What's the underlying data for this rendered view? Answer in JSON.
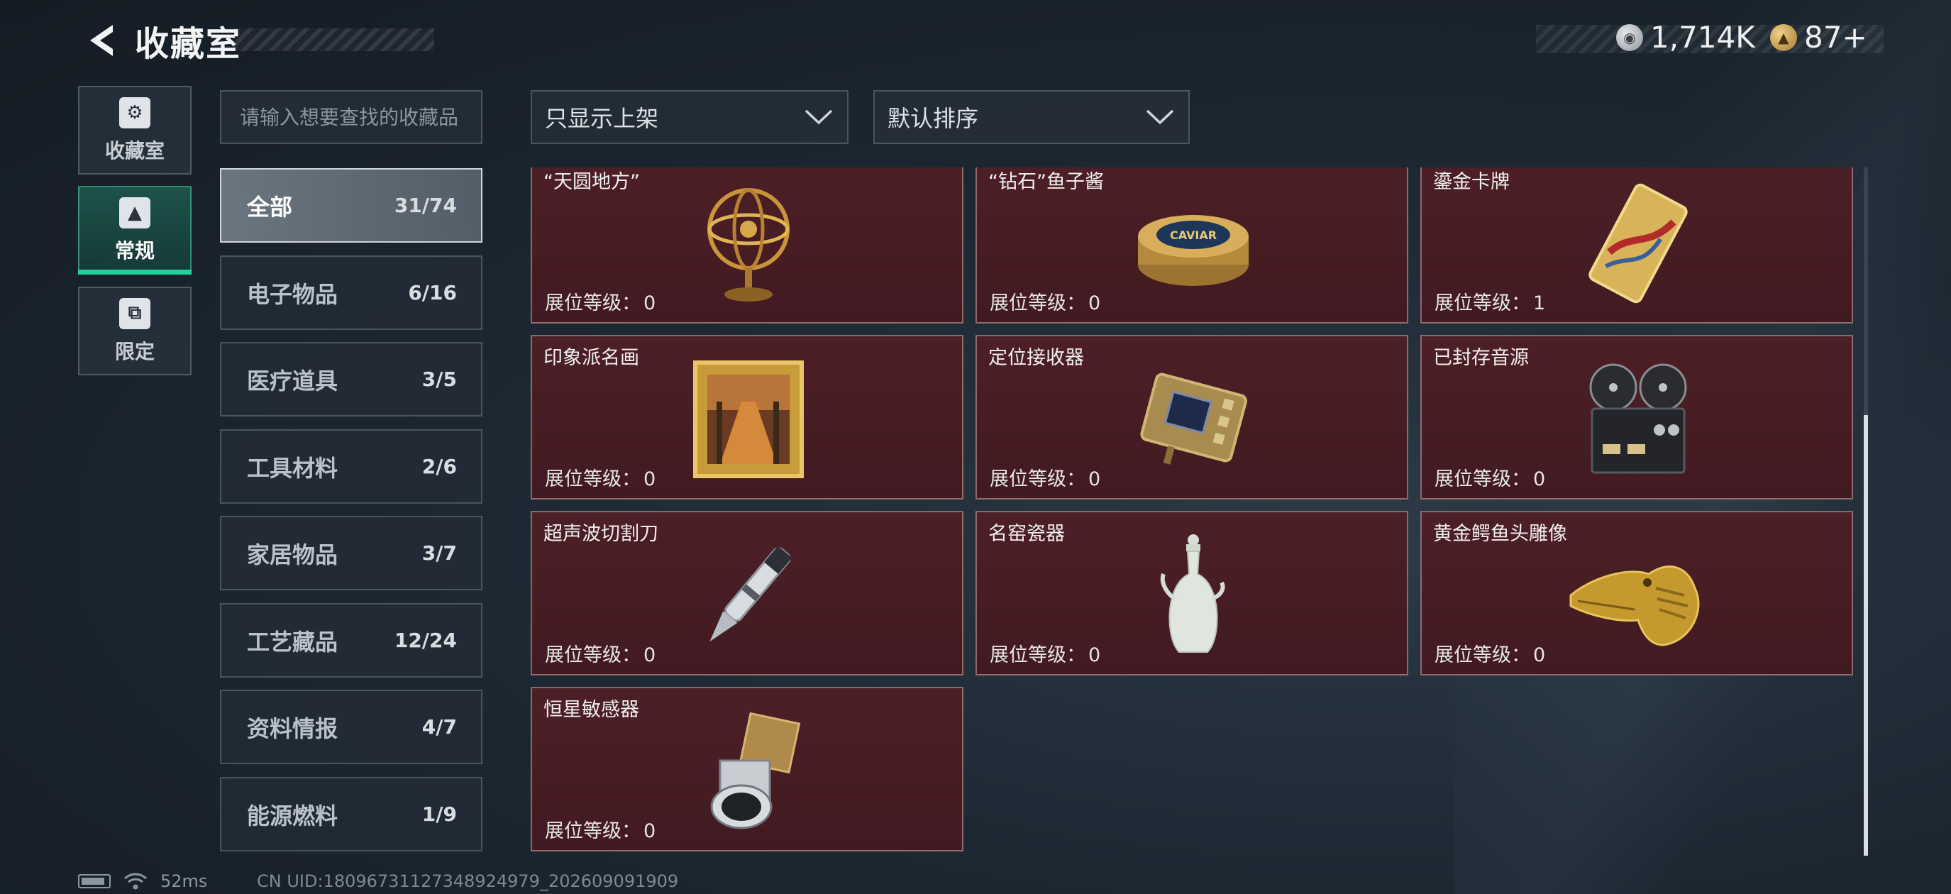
{
  "header": {
    "title": "收藏室",
    "currencies": [
      {
        "icon": "silver-coin-icon",
        "value": "1,714K"
      },
      {
        "icon": "gold-coin-icon",
        "value": "87+"
      }
    ]
  },
  "side_tabs": [
    {
      "label": "收藏室",
      "icon": "collection-icon",
      "active": false
    },
    {
      "label": "常规",
      "icon": "regular-icon",
      "active": true
    },
    {
      "label": "限定",
      "icon": "limited-icon",
      "active": false
    }
  ],
  "search": {
    "placeholder": "请输入想要查找的收藏品"
  },
  "categories": [
    {
      "name": "全部",
      "count": "31/74",
      "active": true
    },
    {
      "name": "电子物品",
      "count": "6/16"
    },
    {
      "name": "医疗道具",
      "count": "3/5"
    },
    {
      "name": "工具材料",
      "count": "2/6"
    },
    {
      "name": "家居物品",
      "count": "3/7"
    },
    {
      "name": "工艺藏品",
      "count": "12/24"
    },
    {
      "name": "资料情报",
      "count": "4/7"
    },
    {
      "name": "能源燃料",
      "count": "1/9"
    }
  ],
  "filters": {
    "shelf": {
      "label": "只显示上架"
    },
    "sort": {
      "label": "默认排序"
    }
  },
  "level_label": "展位等级：",
  "items": [
    {
      "name": "“天圆地方”",
      "level": "0",
      "icon": "armillary-sphere-icon"
    },
    {
      "name": "“钻石”鱼子酱",
      "level": "0",
      "icon": "caviar-tin-icon"
    },
    {
      "name": "鎏金卡牌",
      "level": "1",
      "icon": "gilded-card-icon"
    },
    {
      "name": "印象派名画",
      "level": "0",
      "icon": "framed-painting-icon"
    },
    {
      "name": "定位接收器",
      "level": "0",
      "icon": "gps-receiver-icon"
    },
    {
      "name": "已封存音源",
      "level": "0",
      "icon": "reel-tape-recorder-icon"
    },
    {
      "name": "超声波切割刀",
      "level": "0",
      "icon": "ultrasonic-cutter-icon"
    },
    {
      "name": "名窑瓷器",
      "level": "0",
      "icon": "porcelain-vase-icon"
    },
    {
      "name": "黄金鳄鱼头雕像",
      "level": "0",
      "icon": "golden-crocodile-head-icon"
    },
    {
      "name": "恒星敏感器",
      "level": "0",
      "icon": "star-sensor-icon"
    }
  ],
  "scroll": {
    "thumb_start": 0.36,
    "thumb_end": 1.0
  },
  "status": {
    "ping": "52ms",
    "uid": "CN UID:18096731127348924979_202609091909"
  }
}
